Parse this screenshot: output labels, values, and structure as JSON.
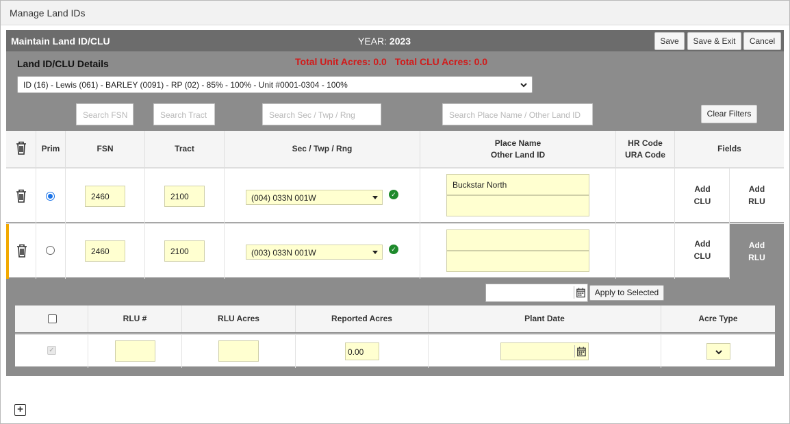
{
  "window": {
    "title": "Manage Land IDs"
  },
  "panel": {
    "title": "Maintain Land ID/CLU",
    "year_label": "YEAR:",
    "year_value": "2023",
    "buttons": {
      "save": "Save",
      "save_exit": "Save & Exit",
      "cancel": "Cancel"
    }
  },
  "details": {
    "label": "Land ID/CLU Details",
    "total_unit_acres": "Total Unit Acres:  0.0",
    "total_clu_acres": "Total CLU Acres:  0.0",
    "selected_land_id": "ID (16) - Lewis (061) - BARLEY (0091) - RP (02) - 85% - 100% - Unit #0001-0304 - 100%"
  },
  "filters": {
    "fsn": "Search FSN",
    "tract": "Search Tract",
    "sec": "Search Sec / Twp / Rng",
    "place": "Search Place Name / Other Land ID",
    "clear": "Clear Filters"
  },
  "grid": {
    "headers": {
      "prim": "Prim",
      "fsn": "FSN",
      "tract": "Tract",
      "sec": "Sec / Twp / Rng",
      "place1": "Place Name",
      "place2": "Other Land ID",
      "hr1": "HR Code",
      "hr2": "URA Code",
      "fields": "Fields"
    },
    "rows": [
      {
        "fsn": "2460",
        "tract": "2100",
        "sec": "(004) 033N 001W",
        "place": "Buckstar North",
        "other": "",
        "add_clu_1": "Add",
        "add_clu_2": "CLU",
        "add_rlu_1": "Add",
        "add_rlu_2": "RLU",
        "primary": true
      },
      {
        "fsn": "2460",
        "tract": "2100",
        "sec": "(003) 033N 001W",
        "place": "",
        "other": "",
        "add_clu_1": "Add",
        "add_clu_2": "CLU",
        "add_rlu_1": "Add",
        "add_rlu_2": "RLU",
        "primary": false
      }
    ]
  },
  "rlu": {
    "apply_button": "Apply to Selected",
    "headers": {
      "rlu_num": "RLU #",
      "rlu_acres": "RLU Acres",
      "reported": "Reported Acres",
      "plant_date": "Plant Date",
      "acre_type": "Acre Type"
    },
    "row": {
      "rlu_num": "",
      "rlu_acres": "",
      "reported": "0.00",
      "plant_date": "",
      "acre_type": ""
    }
  },
  "colors": {
    "header_bar": "#6c6c6c",
    "panel": "#8c8c8c",
    "accent_row": "#f2a900",
    "total_red": "#d11a1a",
    "input_yellow": "#ffffd0",
    "ok_green": "#1e8a2c"
  },
  "icons": [
    "trash-icon",
    "check-circle-icon",
    "calendar-icon",
    "chevron-down-icon",
    "plus-square-icon"
  ]
}
